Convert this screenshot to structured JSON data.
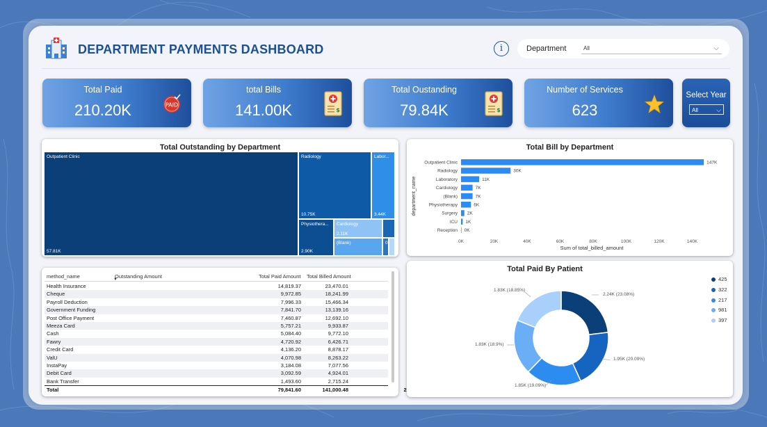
{
  "header": {
    "title": "DEPARTMENT PAYMENTS DASHBOARD",
    "info_glyph": "i",
    "department_filter": {
      "label": "Department",
      "value": "All"
    }
  },
  "kpis": [
    {
      "label": "Total Paid",
      "value": "210.20K",
      "icon": "paid-stamp-icon",
      "badge": "PAID"
    },
    {
      "label": "total Bills",
      "value": "141.00K",
      "icon": "bill-icon"
    },
    {
      "label": "Total Oustanding",
      "value": "79.84K",
      "icon": "bill-icon"
    },
    {
      "label": "Number of Services",
      "value": "623",
      "icon": "star-icon"
    }
  ],
  "year_filter": {
    "label": "Select Year",
    "value": "All"
  },
  "treemap": {
    "title": "Total Outstanding by Department",
    "cells": [
      {
        "name": "Outpatient Clinic",
        "value": "57.81K",
        "color": "#0b3f78"
      },
      {
        "name": "Radiology",
        "value": "10.75K",
        "color": "#0f5aa6"
      },
      {
        "name": "Labor...",
        "value": "3.44K",
        "color": "#2f8fe8"
      },
      {
        "name": "Physiothera...",
        "value": "2.90K",
        "color": "#0d4d92"
      },
      {
        "name": "Cardiology",
        "value": "2.11K",
        "color": "#8fc3f5"
      },
      {
        "name": "(Blank)",
        "value": "",
        "color": "#5aa6ee"
      },
      {
        "name": "",
        "value": "",
        "color": "#1a66b5"
      },
      {
        "name": "0...",
        "value": "",
        "color": "#2a74c2"
      },
      {
        "name": "",
        "value": "",
        "color": "#b6d8f8"
      }
    ]
  },
  "bar_chart": {
    "title": "Total Bill by Department",
    "ylabel": "department_name",
    "xlabel": "Sum of total_billed_amount",
    "x_ticks": [
      "0K",
      "20K",
      "40K",
      "60K",
      "80K",
      "100K",
      "120K",
      "140K"
    ]
  },
  "table": {
    "columns": [
      "method_name",
      "Outstanding Amount",
      "Total Paid Amount",
      "Total Billed Amount"
    ],
    "rows": [
      [
        "Health Insurance",
        "14,819.37",
        "23,470.01",
        "37,613.84"
      ],
      [
        "Cheque",
        "9,972.85",
        "18,241.99",
        "25,378.86"
      ],
      [
        "Payroll Deduction",
        "7,996.33",
        "15,466.34",
        "22,298.75"
      ],
      [
        "Government Funding",
        "7,841.70",
        "13,139.16",
        "20,794.60"
      ],
      [
        "Post Office Payment",
        "7,460.87",
        "12,692.10",
        "18,669.43"
      ],
      [
        "Meeza Card",
        "5,757.21",
        "9,933.87",
        "15,128.76"
      ],
      [
        "Cash",
        "5,084.40",
        "9,772.10",
        "13,946.16"
      ],
      [
        "Fawry",
        "4,720.92",
        "6,426.71",
        "11,147.63"
      ],
      [
        "Credit Card",
        "4,136.20",
        "8,878.17",
        "11,127.49"
      ],
      [
        "ValU",
        "4,070.98",
        "8,263.22",
        "12,334.20"
      ],
      [
        "InstaPay",
        "3,184.08",
        "7,077.56",
        "9,324.64"
      ],
      [
        "Debit Card",
        "3,092.59",
        "4,924.01",
        "8,016.60"
      ],
      [
        "Bank Transfer",
        "1,493.60",
        "2,715.24",
        "4,208.84"
      ]
    ],
    "total": [
      "Total",
      "79,841.60",
      "141,000.48",
      "210,200.30"
    ]
  },
  "donut": {
    "title": "Total Paid By Patient",
    "legend": [
      "425",
      "322",
      "217",
      "981",
      "397"
    ]
  },
  "chart_data": [
    {
      "type": "bar",
      "title": "Total Bill by Department",
      "xlabel": "Sum of total_billed_amount",
      "ylabel": "department_name",
      "categories": [
        "Outpatient Clinic",
        "Radiology",
        "Laboratory",
        "Cardiology",
        "(Blank)",
        "Physiotherapy",
        "Surgery",
        "ICU",
        "Reception"
      ],
      "values": [
        147,
        30,
        11,
        7,
        7,
        6,
        2,
        1,
        0
      ],
      "labels": [
        "147K",
        "30K",
        "11K",
        "7K",
        "7K",
        "6K",
        "2K",
        "1K",
        "0K"
      ],
      "xlim": [
        0,
        150
      ],
      "color": "#2b8cf5"
    },
    {
      "type": "pie",
      "title": "Total Paid By Patient",
      "categories": [
        "425",
        "322",
        "217",
        "981",
        "397"
      ],
      "values": [
        2.24,
        1.95,
        1.85,
        1.83,
        1.83
      ],
      "labels": [
        "2.24K (23.08%)",
        "1.95K (20.09%)",
        "1.85K (19.09%)",
        "1.83K (18.9%)",
        "1.83K (18.85%)"
      ],
      "colors": [
        "#0b3f78",
        "#1565c0",
        "#2d8cf0",
        "#6aaef5",
        "#a8d0fa"
      ]
    }
  ]
}
